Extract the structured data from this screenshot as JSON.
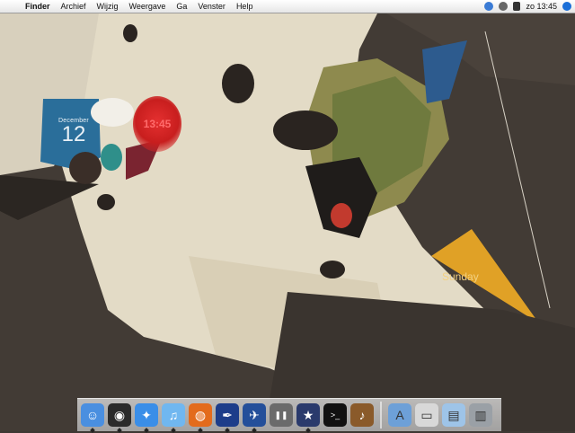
{
  "menubar": {
    "apple_icon": "apple-icon",
    "items": [
      "Finder",
      "Archief",
      "Wijzig",
      "Weergave",
      "Ga",
      "Venster",
      "Help"
    ],
    "clock": "zo 13:45",
    "status_icons": [
      "bluetooth-icon",
      "timemachine-icon",
      "volume-icon",
      "spotlight-icon"
    ]
  },
  "widgets": {
    "calendar": {
      "month": "December",
      "day": "12"
    },
    "clock": {
      "time": "13:45"
    },
    "weather": {
      "label": "Sunday"
    }
  },
  "dock": {
    "apps": [
      {
        "name": "finder-icon",
        "color": "#4a8fe0",
        "glyph": "☺"
      },
      {
        "name": "dashboard-icon",
        "color": "#2b2b2b",
        "glyph": "◉"
      },
      {
        "name": "safari-icon",
        "color": "#3a8ee8",
        "glyph": "✦"
      },
      {
        "name": "itunes-icon",
        "color": "#70b7f0",
        "glyph": "♫"
      },
      {
        "name": "firefox-icon",
        "color": "#e36b1c",
        "glyph": "◍"
      },
      {
        "name": "quill-icon",
        "color": "#1d3d8a",
        "glyph": "✒"
      },
      {
        "name": "adium-icon",
        "color": "#244f9a",
        "glyph": "✈"
      },
      {
        "name": "pause-icon",
        "color": "#6b6b6b",
        "glyph": "❚❚"
      },
      {
        "name": "imovie-icon",
        "color": "#2a3a6c",
        "glyph": "★"
      },
      {
        "name": "terminal-icon",
        "color": "#111111",
        "glyph": ">_"
      },
      {
        "name": "garageband-icon",
        "color": "#8a5a2a",
        "glyph": "♪"
      }
    ],
    "docs": [
      {
        "name": "applications-folder-icon",
        "color": "#6da0d8",
        "glyph": "A"
      },
      {
        "name": "disk-icon",
        "color": "#d8d8d8",
        "glyph": "▭"
      },
      {
        "name": "documents-icon",
        "color": "#9ec4e8",
        "glyph": "▤"
      },
      {
        "name": "trash-icon",
        "color": "#9aa0a6",
        "glyph": "▥"
      }
    ]
  }
}
